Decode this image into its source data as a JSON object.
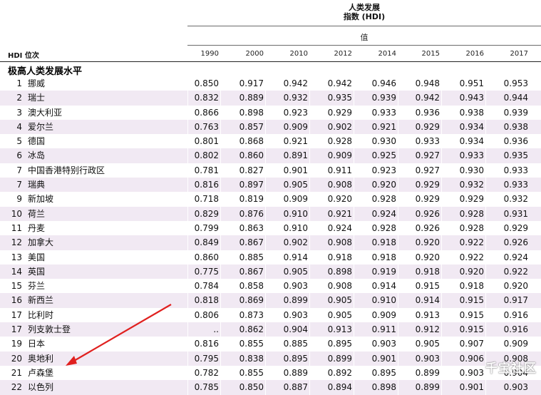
{
  "header": {
    "title_line1": "人类发展",
    "title_line2": "指数 (HDI)",
    "value_label": "值",
    "rank_label": "HDI 位次",
    "years": [
      "1990",
      "2000",
      "2010",
      "2012",
      "2014",
      "2015",
      "2016",
      "2017"
    ]
  },
  "section_title": "极高人类发展水平",
  "rows": [
    {
      "rank": "1",
      "country": "挪威",
      "values": [
        "0.850",
        "0.917",
        "0.942",
        "0.942",
        "0.946",
        "0.948",
        "0.951",
        "0.953"
      ]
    },
    {
      "rank": "2",
      "country": "瑞士",
      "values": [
        "0.832",
        "0.889",
        "0.932",
        "0.935",
        "0.939",
        "0.942",
        "0.943",
        "0.944"
      ]
    },
    {
      "rank": "3",
      "country": "澳大利亚",
      "values": [
        "0.866",
        "0.898",
        "0.923",
        "0.929",
        "0.933",
        "0.936",
        "0.938",
        "0.939"
      ]
    },
    {
      "rank": "4",
      "country": "爱尔兰",
      "values": [
        "0.763",
        "0.857",
        "0.909",
        "0.902",
        "0.921",
        "0.929",
        "0.934",
        "0.938"
      ]
    },
    {
      "rank": "5",
      "country": "德国",
      "values": [
        "0.801",
        "0.868",
        "0.921",
        "0.928",
        "0.930",
        "0.933",
        "0.934",
        "0.936"
      ]
    },
    {
      "rank": "6",
      "country": "冰岛",
      "values": [
        "0.802",
        "0.860",
        "0.891",
        "0.909",
        "0.925",
        "0.927",
        "0.933",
        "0.935"
      ]
    },
    {
      "rank": "7",
      "country": "中国香港特别行政区",
      "values": [
        "0.781",
        "0.827",
        "0.901",
        "0.911",
        "0.923",
        "0.927",
        "0.930",
        "0.933"
      ]
    },
    {
      "rank": "7",
      "country": "瑞典",
      "values": [
        "0.816",
        "0.897",
        "0.905",
        "0.908",
        "0.920",
        "0.929",
        "0.932",
        "0.933"
      ]
    },
    {
      "rank": "9",
      "country": "新加坡",
      "values": [
        "0.718",
        "0.819",
        "0.909",
        "0.920",
        "0.928",
        "0.929",
        "0.929",
        "0.932"
      ]
    },
    {
      "rank": "10",
      "country": "荷兰",
      "values": [
        "0.829",
        "0.876",
        "0.910",
        "0.921",
        "0.924",
        "0.926",
        "0.928",
        "0.931"
      ]
    },
    {
      "rank": "11",
      "country": "丹麦",
      "values": [
        "0.799",
        "0.863",
        "0.910",
        "0.924",
        "0.928",
        "0.926",
        "0.928",
        "0.929"
      ]
    },
    {
      "rank": "12",
      "country": "加拿大",
      "values": [
        "0.849",
        "0.867",
        "0.902",
        "0.908",
        "0.918",
        "0.920",
        "0.922",
        "0.926"
      ]
    },
    {
      "rank": "13",
      "country": "美国",
      "values": [
        "0.860",
        "0.885",
        "0.914",
        "0.918",
        "0.918",
        "0.920",
        "0.922",
        "0.924"
      ]
    },
    {
      "rank": "14",
      "country": "英国",
      "values": [
        "0.775",
        "0.867",
        "0.905",
        "0.898",
        "0.919",
        "0.918",
        "0.920",
        "0.922"
      ]
    },
    {
      "rank": "15",
      "country": "芬兰",
      "values": [
        "0.784",
        "0.858",
        "0.903",
        "0.908",
        "0.914",
        "0.915",
        "0.918",
        "0.920"
      ]
    },
    {
      "rank": "16",
      "country": "新西兰",
      "values": [
        "0.818",
        "0.869",
        "0.899",
        "0.905",
        "0.910",
        "0.914",
        "0.915",
        "0.917"
      ]
    },
    {
      "rank": "17",
      "country": "比利时",
      "values": [
        "0.806",
        "0.873",
        "0.903",
        "0.905",
        "0.909",
        "0.913",
        "0.915",
        "0.916"
      ]
    },
    {
      "rank": "17",
      "country": "列支敦士登",
      "values": [
        "..",
        "0.862",
        "0.904",
        "0.913",
        "0.911",
        "0.912",
        "0.915",
        "0.916"
      ]
    },
    {
      "rank": "19",
      "country": "日本",
      "values": [
        "0.816",
        "0.855",
        "0.885",
        "0.895",
        "0.903",
        "0.905",
        "0.907",
        "0.909"
      ]
    },
    {
      "rank": "20",
      "country": "奥地利",
      "values": [
        "0.795",
        "0.838",
        "0.895",
        "0.899",
        "0.901",
        "0.903",
        "0.906",
        "0.908"
      ]
    },
    {
      "rank": "21",
      "country": "卢森堡",
      "values": [
        "0.782",
        "0.855",
        "0.889",
        "0.892",
        "0.895",
        "0.899",
        "0.903",
        "0.904"
      ]
    },
    {
      "rank": "22",
      "country": "以色列",
      "values": [
        "0.785",
        "0.850",
        "0.887",
        "0.894",
        "0.898",
        "0.899",
        "0.901",
        "0.903"
      ]
    }
  ],
  "watermark": "千宝社区",
  "colors": {
    "shaded_row": "#f1e9f3",
    "arrow": "#e0201f",
    "rule": "#6b6b6b"
  }
}
